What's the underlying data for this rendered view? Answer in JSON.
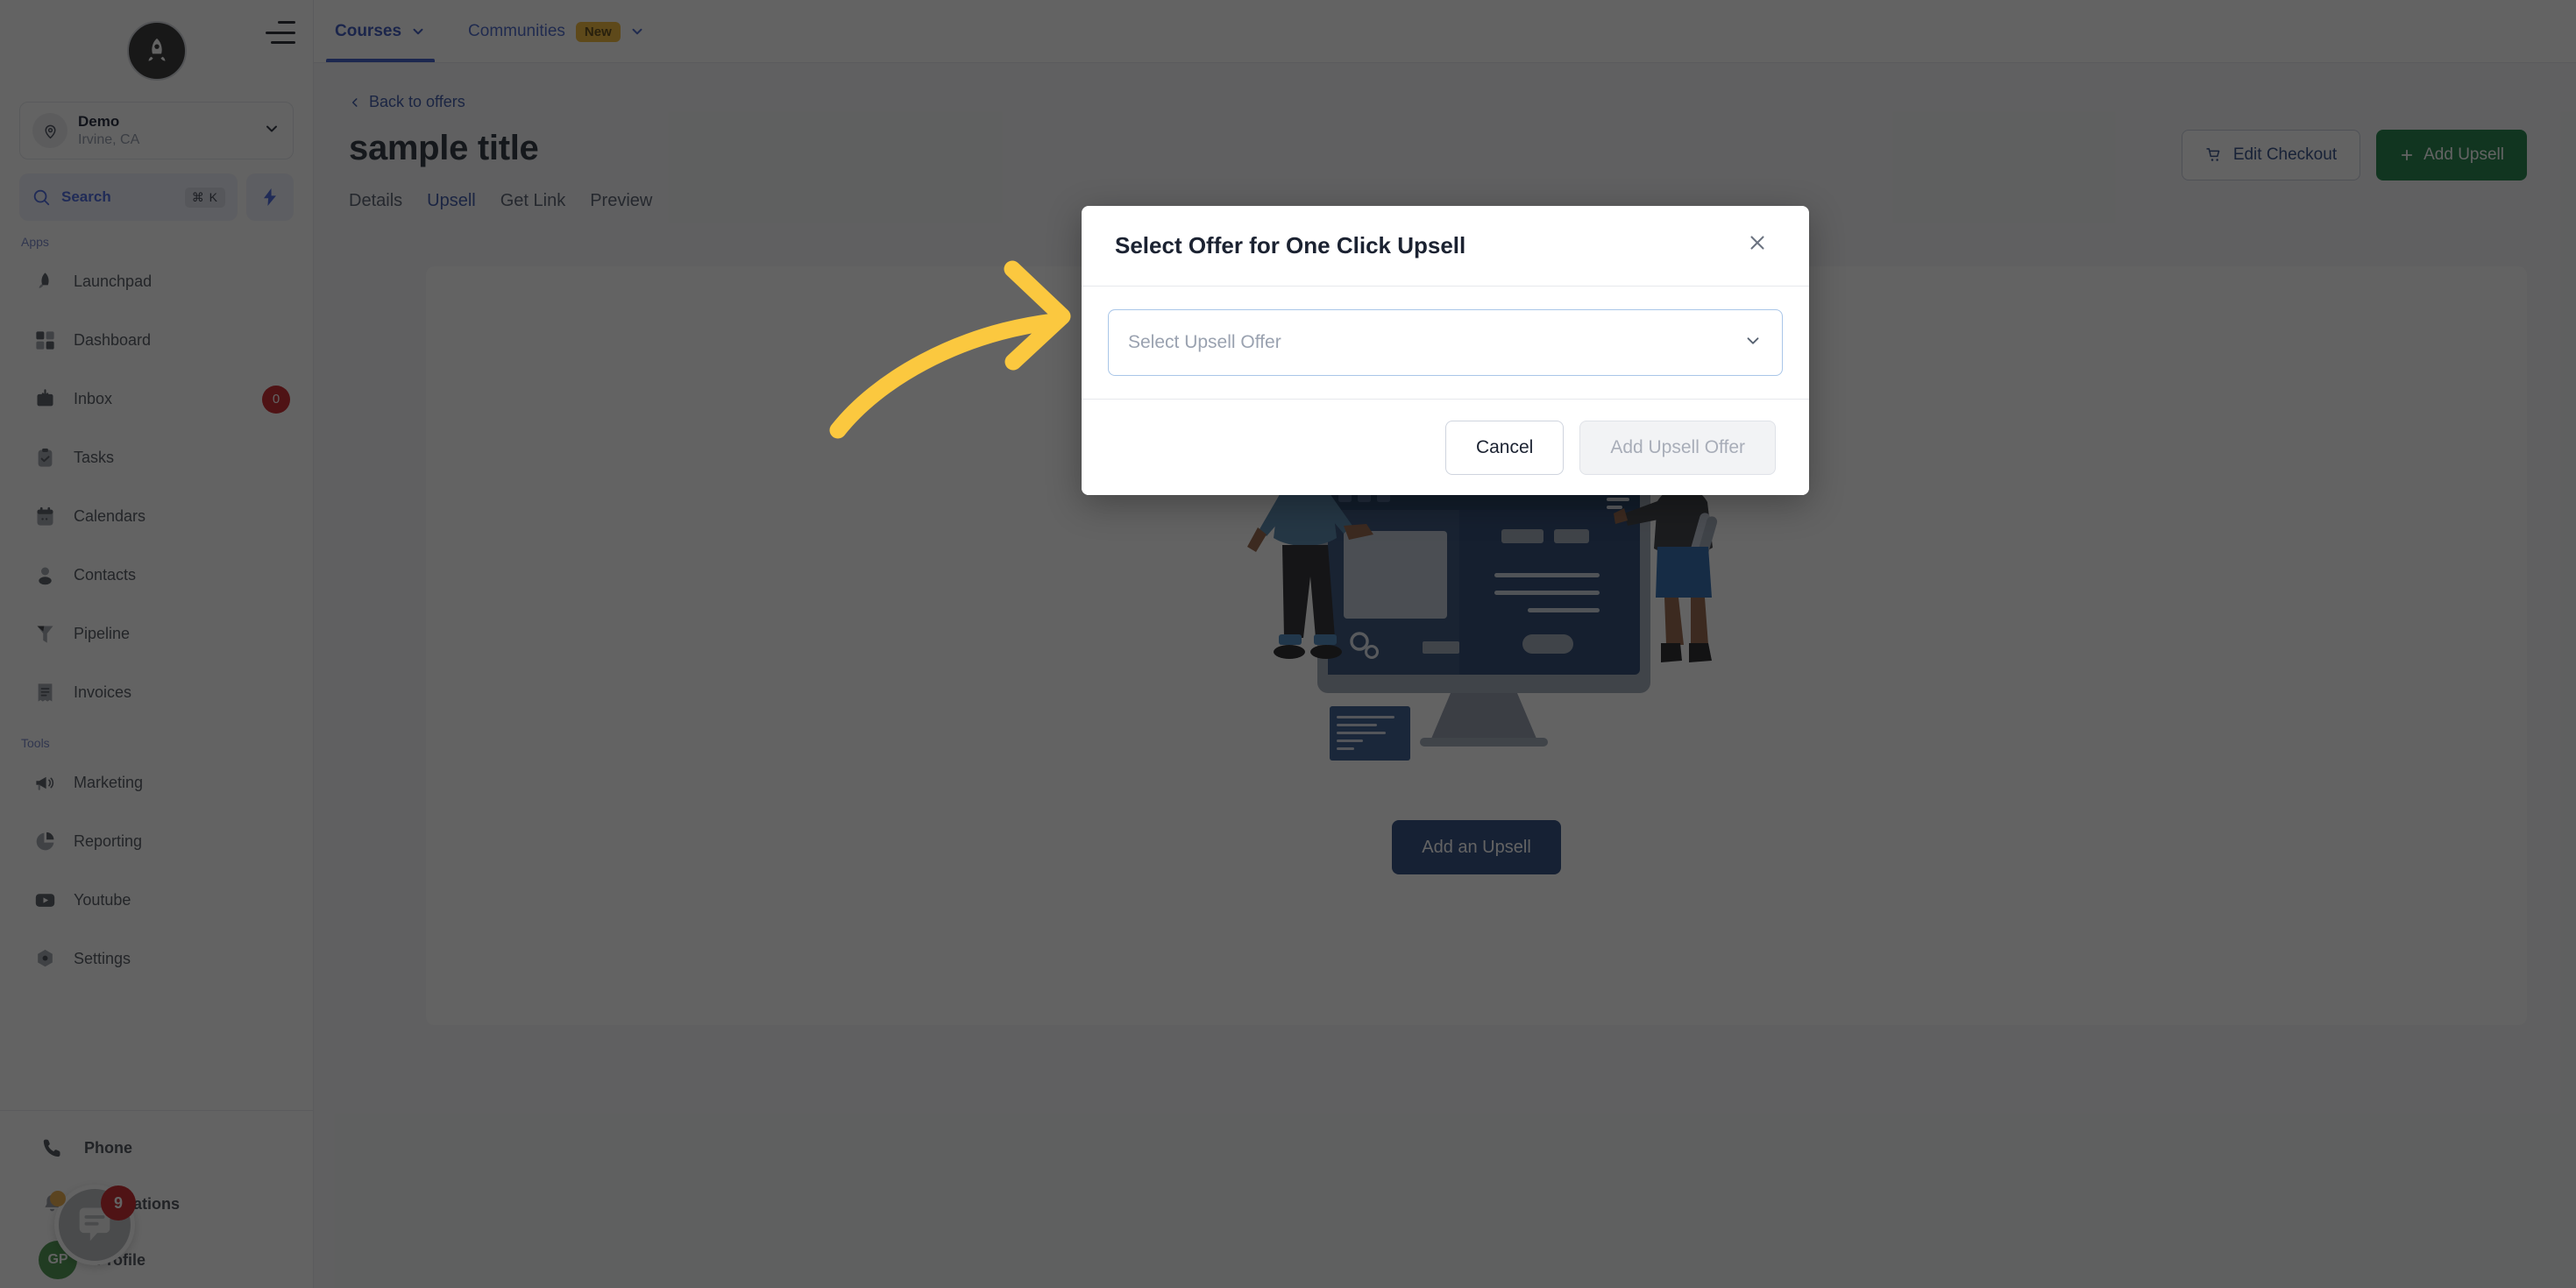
{
  "sidebar": {
    "logo_icon": "rocket-logo-icon",
    "workspace": {
      "name": "Demo",
      "location": "Irvine, CA",
      "avatar_icon": "location-pin-icon",
      "caret_icon": "chevron-down-icon"
    },
    "search": {
      "label": "Search",
      "shortcut": "⌘ K",
      "icon": "search-icon"
    },
    "quick_action_icon": "lightning-bolt-icon",
    "sections": [
      {
        "label": "Apps",
        "items": [
          {
            "label": "Launchpad",
            "icon": "launchpad-icon",
            "badge": null
          },
          {
            "label": "Dashboard",
            "icon": "dashboard-grid-icon",
            "badge": null
          },
          {
            "label": "Inbox",
            "icon": "inbox-icon",
            "badge": "0"
          },
          {
            "label": "Tasks",
            "icon": "tasks-clipboard-icon",
            "badge": null
          },
          {
            "label": "Calendars",
            "icon": "calendar-icon",
            "badge": null
          },
          {
            "label": "Contacts",
            "icon": "contacts-person-icon",
            "badge": null
          },
          {
            "label": "Pipeline",
            "icon": "pipeline-funnel-icon",
            "badge": null
          },
          {
            "label": "Invoices",
            "icon": "invoice-list-icon",
            "badge": null
          }
        ]
      },
      {
        "label": "Tools",
        "items": [
          {
            "label": "Marketing",
            "icon": "megaphone-icon",
            "badge": null
          },
          {
            "label": "Reporting",
            "icon": "pie-chart-icon",
            "badge": null
          },
          {
            "label": "Youtube",
            "icon": "youtube-icon",
            "badge": null
          },
          {
            "label": "Settings",
            "icon": "gear-icon",
            "badge": null
          }
        ]
      }
    ],
    "bottom_items": [
      {
        "label": "Phone",
        "icon": "phone-icon",
        "badge": null
      },
      {
        "label": "Notifications",
        "icon": "bell-icon",
        "badge": null
      },
      {
        "label": "Profile",
        "icon": "avatar-initials",
        "initials": "GP",
        "badge": null
      }
    ],
    "chat_widget": {
      "icon": "chat-bubble-icon",
      "badge": "9"
    }
  },
  "topbar": {
    "menu_icon": "hamburger-collapse-icon",
    "tabs": [
      {
        "label": "Courses",
        "active": true,
        "caret_icon": "chevron-down-icon",
        "pill": null
      },
      {
        "label": "Communities",
        "active": false,
        "caret_icon": "chevron-down-icon",
        "pill": "New"
      }
    ]
  },
  "main": {
    "back_link": "Back to offers",
    "back_icon": "chevron-left-icon",
    "page_title": "sample title",
    "subtabs": [
      {
        "label": "Details",
        "active": false
      },
      {
        "label": "Upsell",
        "active": true
      },
      {
        "label": "Get Link",
        "active": false
      },
      {
        "label": "Preview",
        "active": false
      }
    ],
    "actions": {
      "edit_checkout": "Edit Checkout",
      "edit_checkout_icon": "shopping-cart-icon",
      "add_upsell": "Add Upsell",
      "add_upsell_icon": "plus-icon"
    },
    "empty_state": {
      "illustration": "two-people-with-monitor-illustration",
      "cta_label": "Add an Upsell"
    }
  },
  "modal": {
    "title": "Select Offer for One Click Upsell",
    "close_icon": "close-icon",
    "select": {
      "placeholder": "Select Upsell Offer",
      "value": "",
      "caret_icon": "chevron-down-icon"
    },
    "cancel_label": "Cancel",
    "submit_label": "Add Upsell Offer",
    "submit_disabled": true
  },
  "annotation": {
    "arrow_icon": "curved-arrow-right-icon",
    "arrow_color": "#fbc83f",
    "highlight_color": "#fbc83f"
  },
  "colors": {
    "accent_blue": "#2f4fc4",
    "green": "#0f7a3d",
    "badge_red": "#c4161c",
    "pill_yellow": "#f0b429",
    "highlight_yellow": "#fbc83f",
    "overlay": "rgba(18,18,18,0.66)"
  }
}
